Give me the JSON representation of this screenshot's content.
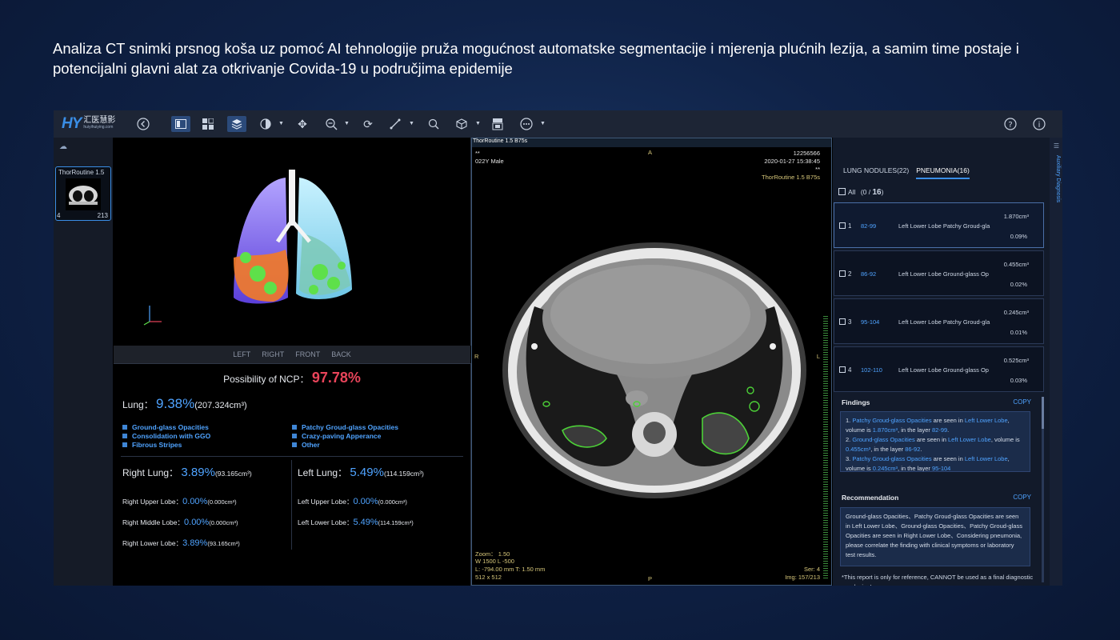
{
  "headline": "Analiza CT snimki prsnog koša uz pomoć AI tehnologije pruža mogućnost automatske segmentacije i mjerenja plućnih lezija, a samim time postaje i potencijalni glavni alat za otkrivanje Covida-19 u područjima epidemije",
  "brand": {
    "mark": "HY",
    "name_cn": "汇医慧影",
    "url": "huiyihuiying.com"
  },
  "toolbar_icons": [
    "back-icon",
    "layout-icon",
    "grid-icon",
    "layers-icon",
    "contrast-icon",
    "move-icon",
    "zoom-icon",
    "rotate-icon",
    "measure-icon",
    "search-icon",
    "volume-icon",
    "dicom-icon",
    "more-icon",
    "help-icon",
    "info-icon"
  ],
  "series": {
    "title": "ThorRoutine 1.5 B75s",
    "thumb_title": "ThorRoutine 1.5",
    "thumb_left": "4",
    "thumb_count": "213"
  },
  "view_buttons": [
    "LEFT",
    "RIGHT",
    "FRONT",
    "BACK"
  ],
  "stats": {
    "ncp_label": "Possibility of NCP：",
    "ncp_value": "97.78%",
    "lung_label": "Lung：",
    "lung_pct": "9.38%",
    "lung_vol": "(207.324cm³)",
    "legend": [
      "Ground-glass Opacities",
      "Consolidation with GGO",
      "Fibrous Stripes",
      "Patchy Groud-glass Opacities",
      "Crazy-paving Apperance",
      "Other"
    ],
    "right_lung": {
      "label": "Right Lung：",
      "pct": "3.89%",
      "vol": "(93.165cm³)"
    },
    "left_lung": {
      "label": "Left Lung：",
      "pct": "5.49%",
      "vol": "(114.159cm³)"
    },
    "right_lobes": [
      {
        "label": "Right Upper Lobe：",
        "pct": "0.00%",
        "vol": "(0.000cm³)"
      },
      {
        "label": "Right Middle Lobe：",
        "pct": "0.00%",
        "vol": "(0.000cm³)"
      },
      {
        "label": "Right Lower Lobe：",
        "pct": "3.89%",
        "vol": "(93.165cm³)"
      }
    ],
    "left_lobes": [
      {
        "label": "Left Upper Lobe：",
        "pct": "0.00%",
        "vol": "(0.000cm³)"
      },
      {
        "label": "Left Lower Lobe：",
        "pct": "5.49%",
        "vol": "(114.159cm³)"
      }
    ]
  },
  "ct_overlay": {
    "tl1": "**",
    "tl2": "022Y Male",
    "top_center": "A",
    "tr1": "12256566",
    "tr2": "2020-01-27 15:38:45",
    "tr3": "**",
    "tr4": "ThorRoutine 1.5 B75s",
    "left_marker": "R",
    "right_marker": "L",
    "bl1": "Zoom： 1.50",
    "bl2": "W 1500 L -500",
    "bl3": "L: -794.00 mm T: 1.50 mm",
    "bl4": "512 x 512",
    "bottom_center": "P",
    "br1": "Ser: 4",
    "br2": "Img: 157/213"
  },
  "right_panel": {
    "tab_nodules": "LUNG NODULES(22)",
    "tab_pneumonia": "PNEUMONIA(16)",
    "all_prefix": "All",
    "all_count_a": "(0 /",
    "all_count_b": "16",
    "all_count_c": ")",
    "side_label": "Auxiliary Diagnosis",
    "lesions": [
      {
        "num": "1",
        "range": "82-99",
        "lobe": "Left Lower Lobe  Patchy Groud-gla",
        "vol": "1.870cm³",
        "pct": "0.09%"
      },
      {
        "num": "2",
        "range": "86-92",
        "lobe": "Left Lower Lobe  Ground-glass Op",
        "vol": "0.455cm³",
        "pct": "0.02%"
      },
      {
        "num": "3",
        "range": "95-104",
        "lobe": "Left Lower Lobe  Patchy Groud-gla",
        "vol": "0.245cm³",
        "pct": "0.01%"
      },
      {
        "num": "4",
        "range": "102-110",
        "lobe": "Left Lower Lobe  Ground-glass Op",
        "vol": "0.525cm³",
        "pct": "0.03%"
      }
    ],
    "findings_title": "Findings",
    "copy_label": "COPY",
    "findings": [
      {
        "n": "1.",
        "type": "Patchy Groud-glass Opacities",
        "mid": " are seen in ",
        "lobe": "Left Lower Lobe",
        "vol_pre": ", volume is ",
        "vol": "1.870cm³",
        "layer_pre": ",   in the layer ",
        "layer": "82-99",
        "end": "."
      },
      {
        "n": "2.",
        "type": "Ground-glass Opacities",
        "mid": " are seen in ",
        "lobe": "Left Lower Lobe",
        "vol_pre": ", volume is ",
        "vol": "0.455cm³",
        "layer_pre": ",   in the layer ",
        "layer": "86-92",
        "end": "."
      },
      {
        "n": "3.",
        "type": "Patchy Groud-glass Opacities",
        "mid": " are seen in ",
        "lobe": "Left Lower Lobe",
        "vol_pre": ", volume is ",
        "vol": "0.245cm³",
        "layer_pre": ",   in the layer ",
        "layer": "95-104",
        "end": ""
      }
    ],
    "recommendation_title": "Recommendation",
    "recommendation": "Ground-glass Opacities、Patchy Groud-glass Opacities are seen in Left Lower Lobe、Ground-glass Opacities、Patchy Groud-glass Opacities are seen in Right Lower Lobe、Considering pneumonia, please correlate the finding with clinical symptoms or laboratory test results.",
    "disclaimer": "*This report is only for reference, CANNOT be used as a final diagnostic conclusion!"
  },
  "colors": {
    "accent": "#4fa3ff",
    "ncp": "#e8445a",
    "lesion_outline": "#4cd137",
    "background": "#0f2247"
  }
}
